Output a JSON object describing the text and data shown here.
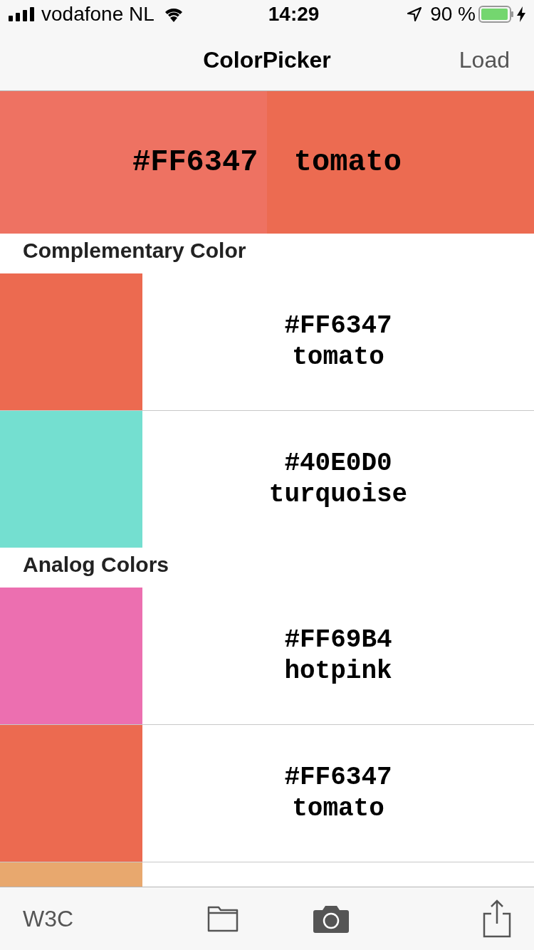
{
  "status_bar": {
    "carrier": "vodafone NL",
    "time": "14:29",
    "battery": "90 %"
  },
  "nav": {
    "title": "ColorPicker",
    "action": "Load"
  },
  "header": {
    "text": "#FF6347  tomato",
    "halves": [
      {
        "color": "#ee7262"
      },
      {
        "color": "#ec6b51"
      }
    ]
  },
  "sections": [
    {
      "title": "Complementary Color",
      "rows": [
        {
          "color": "#ec6a50",
          "hex": "#FF6347",
          "name": "tomato"
        },
        {
          "color": "#74dfd0",
          "hex": "#40E0D0",
          "name": "turquoise"
        }
      ]
    },
    {
      "title": "Analog Colors",
      "rows": [
        {
          "color": "#ec6fb0",
          "hex": "#FF69B4",
          "name": "hotpink"
        },
        {
          "color": "#ec6a50",
          "hex": "#FF6347",
          "name": "tomato"
        },
        {
          "color": "#e8a86e"
        }
      ]
    }
  ],
  "toolbar": {
    "label": "W3C"
  }
}
